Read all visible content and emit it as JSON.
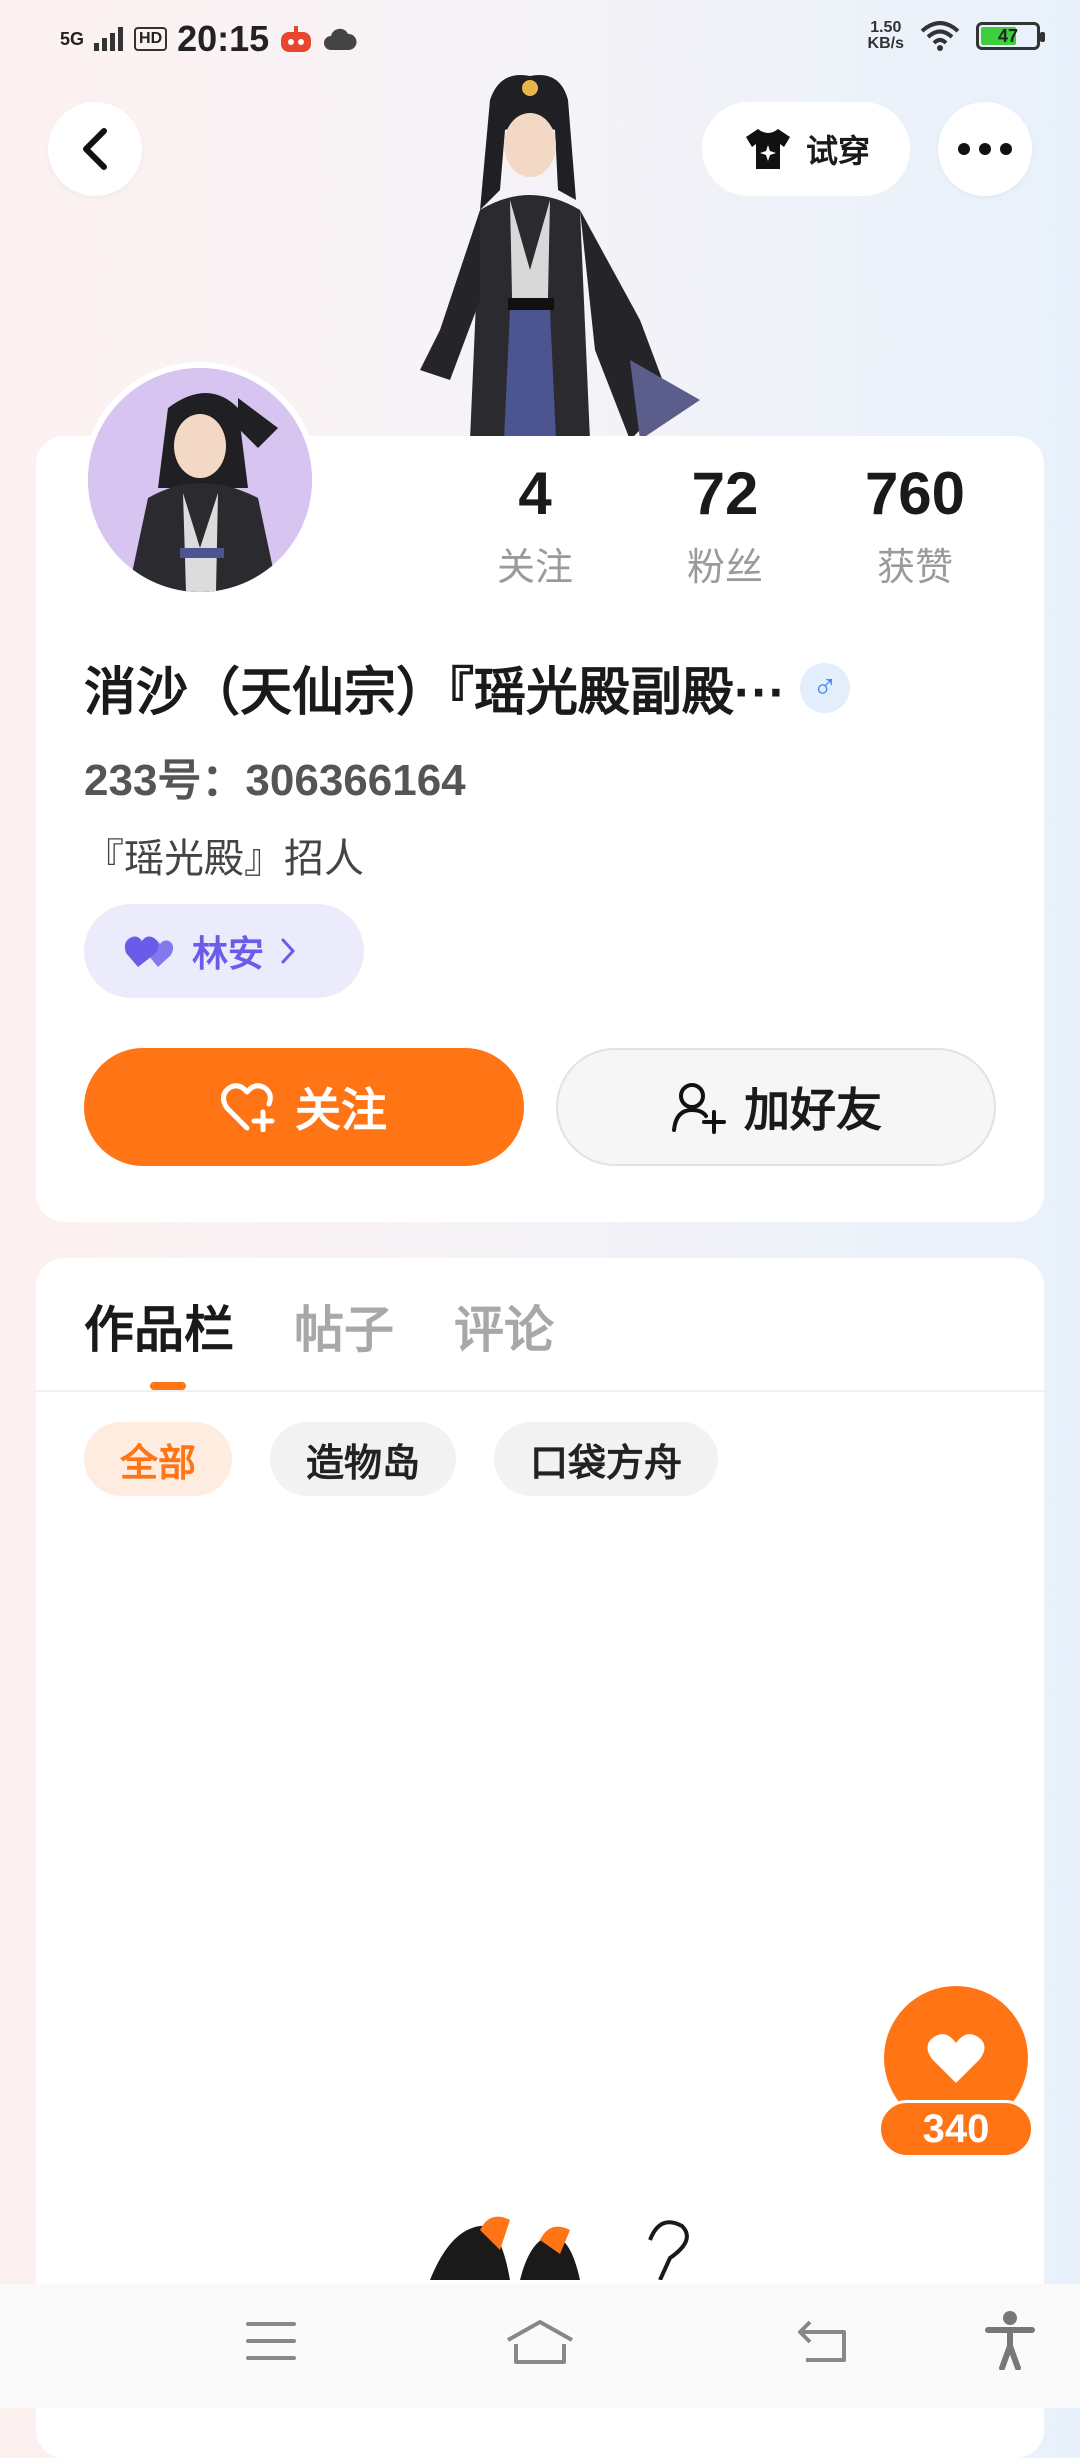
{
  "status_bar": {
    "signal": "5G",
    "hd": "HD",
    "time": "20:15",
    "net_speed_value": "1.50",
    "net_speed_unit": "KB/s",
    "battery": "47"
  },
  "header": {
    "tryon_label": "试穿"
  },
  "profile": {
    "stats": [
      {
        "value": "4",
        "label": "关注"
      },
      {
        "value": "72",
        "label": "粉丝"
      },
      {
        "value": "760",
        "label": "获赞"
      }
    ],
    "name": "消沙（天仙宗）『瑶光殿副殿···",
    "gender_symbol": "♂",
    "uid": "233号：306366164",
    "bio": "『瑶光殿』招人",
    "partner_name": "林安",
    "follow_label": "关注",
    "add_friend_label": "加好友"
  },
  "works": {
    "tabs": [
      {
        "label": "作品栏",
        "active": true
      },
      {
        "label": "帖子",
        "active": false
      },
      {
        "label": "评论",
        "active": false
      }
    ],
    "chips": [
      {
        "label": "全部",
        "active": true
      },
      {
        "label": "造物岛",
        "active": false
      },
      {
        "label": "口袋方舟",
        "active": false
      }
    ]
  },
  "like_fab": {
    "count": "340"
  },
  "colors": {
    "accent": "#ff7414",
    "partner": "#6a5ce8"
  }
}
